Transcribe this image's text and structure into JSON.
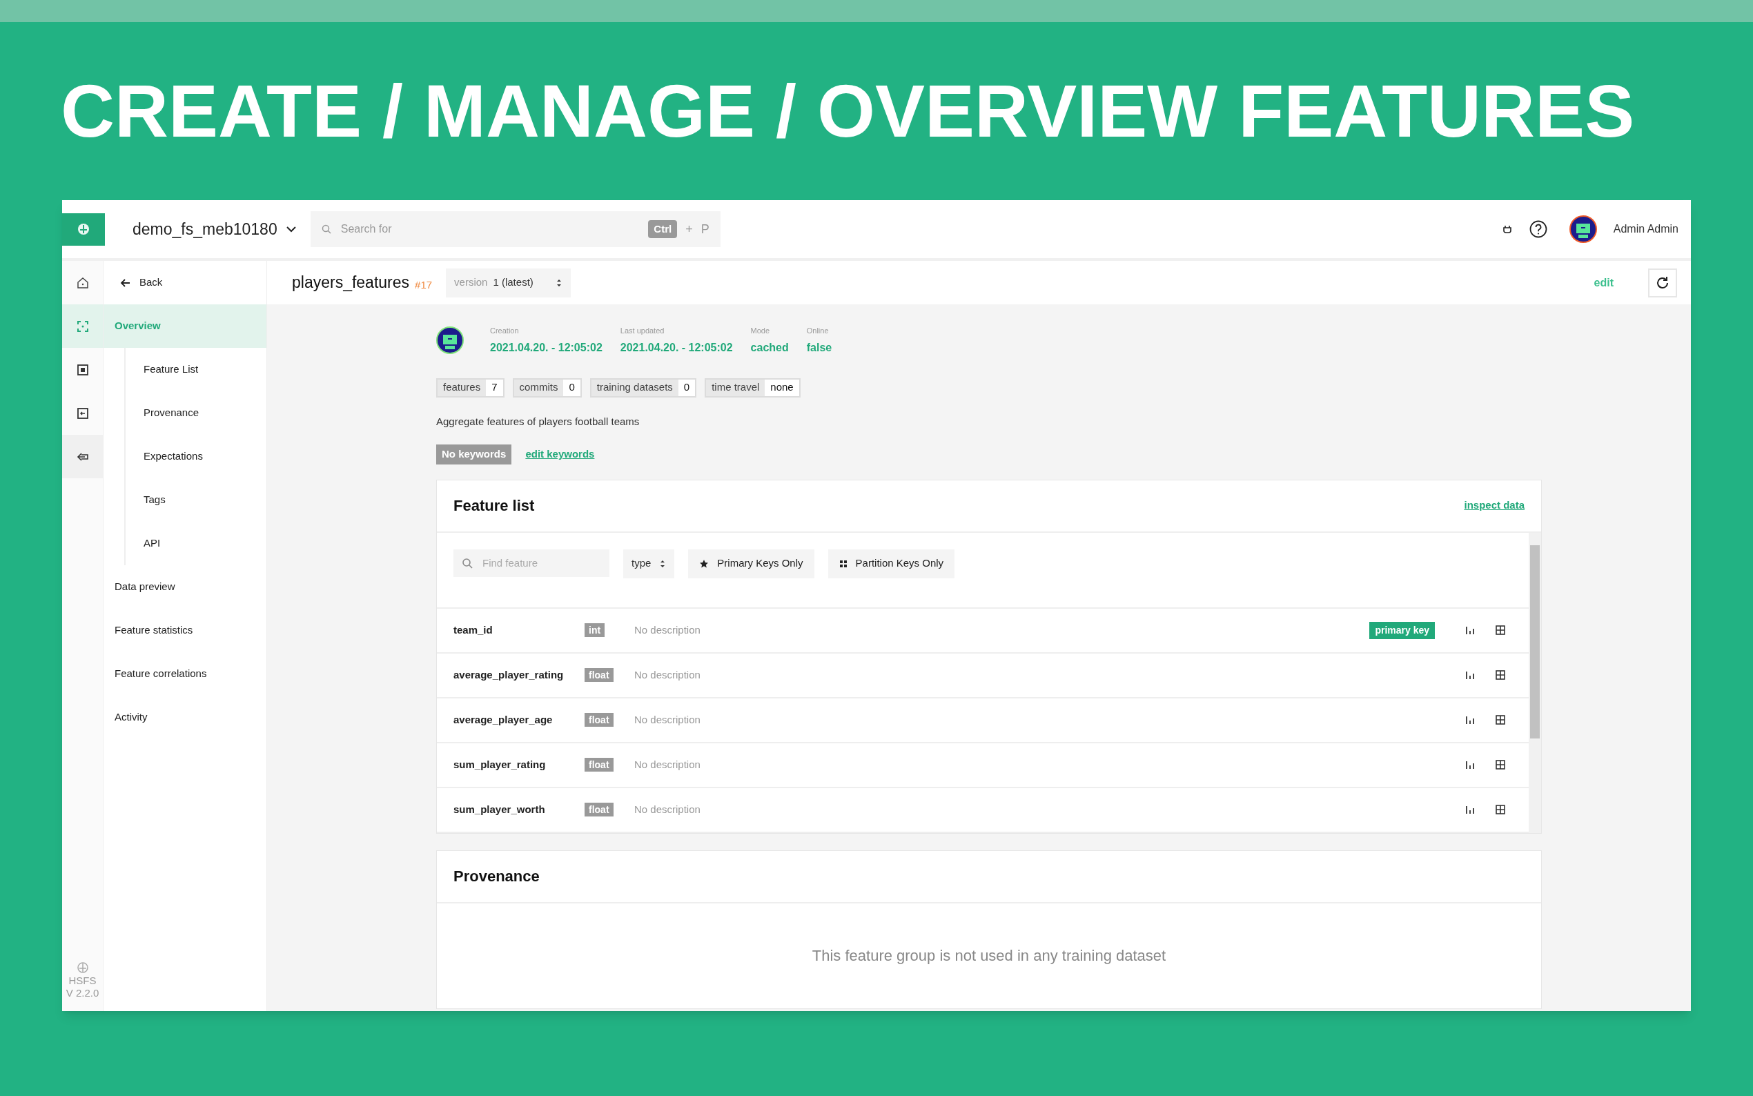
{
  "banner_title": "CREATE / MANAGE / OVERVIEW FEATURES",
  "top_bar": {
    "project": "demo_fs_meb10180",
    "search": {
      "placeholder": "Search for",
      "shortcut_key": "Ctrl",
      "shortcut_plus": "+",
      "shortcut_letter": "P"
    },
    "user": "Admin Admin"
  },
  "icon_rail": [
    {
      "kind": "home",
      "selected": false
    },
    {
      "kind": "overview",
      "selected": true
    },
    {
      "kind": "list",
      "selected": false
    },
    {
      "kind": "export",
      "selected": false
    },
    {
      "kind": "back",
      "selected": false
    }
  ],
  "rail_footer": {
    "label": "HSFS",
    "version": "V 2.2.0"
  },
  "nav": {
    "back": "Back",
    "items": [
      {
        "label": "Overview",
        "selected": true,
        "children": [
          {
            "label": "Feature List"
          },
          {
            "label": "Provenance"
          },
          {
            "label": "Expectations"
          },
          {
            "label": "Tags"
          },
          {
            "label": "API"
          }
        ]
      },
      {
        "label": "Data preview",
        "selected": false
      },
      {
        "label": "Feature statistics",
        "selected": false
      },
      {
        "label": "Feature correlations",
        "selected": false
      },
      {
        "label": "Activity",
        "selected": false
      }
    ]
  },
  "header": {
    "title": "players_features",
    "id": "#17",
    "version_label": "version",
    "version_value": "1 (latest)",
    "edit": "edit"
  },
  "meta": [
    {
      "label": "Creation",
      "value": "2021.04.20. - 12:05:02"
    },
    {
      "label": "Last updated",
      "value": "2021.04.20. - 12:05:02"
    },
    {
      "label": "Mode",
      "value": "cached"
    },
    {
      "label": "Online",
      "value": "false"
    }
  ],
  "counts": [
    {
      "label": "features",
      "value": "7"
    },
    {
      "label": "commits",
      "value": "0"
    },
    {
      "label": "training datasets",
      "value": "0"
    },
    {
      "label": "time travel",
      "value": "none"
    }
  ],
  "description": "Aggregate features of players football teams",
  "keywords": {
    "badge": "No keywords",
    "link": "edit keywords"
  },
  "feature_list": {
    "title": "Feature list",
    "link": "inspect data",
    "search": {
      "placeholder": "Find feature"
    },
    "type_filter": "type",
    "filters": [
      {
        "kind": "star",
        "label": "Primary Keys Only"
      },
      {
        "kind": "partition",
        "label": "Partition Keys Only"
      }
    ],
    "rows": [
      {
        "name": "team_id",
        "type": "int",
        "description": "No description",
        "key_badge": "primary key"
      },
      {
        "name": "average_player_rating",
        "type": "float",
        "description": "No description"
      },
      {
        "name": "average_player_age",
        "type": "float",
        "description": "No description"
      },
      {
        "name": "sum_player_rating",
        "type": "float",
        "description": "No description"
      },
      {
        "name": "sum_player_worth",
        "type": "float",
        "description": "No description"
      }
    ]
  },
  "provenance": {
    "title": "Provenance",
    "message": "This feature group is not used in any training dataset"
  }
}
